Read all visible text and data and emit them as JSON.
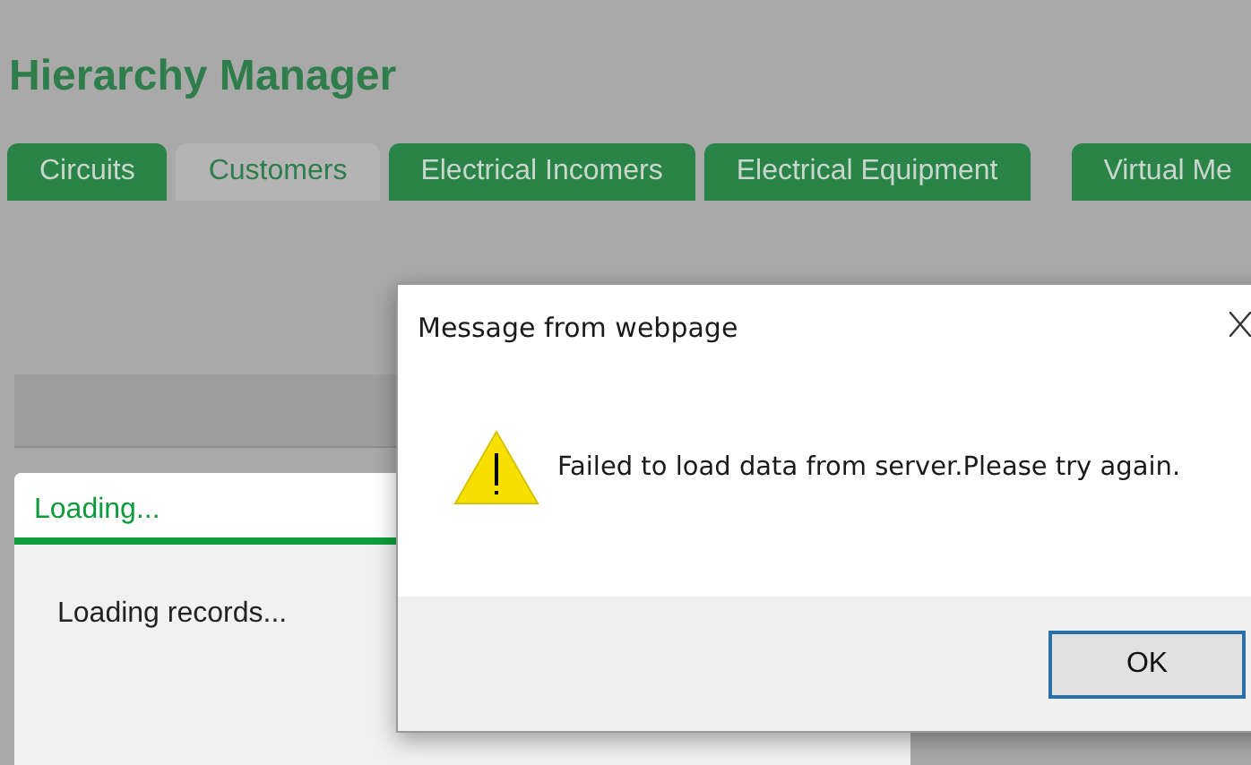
{
  "page": {
    "title": "Hierarchy Manager"
  },
  "tabs": [
    {
      "label": "Circuits",
      "selected": false
    },
    {
      "label": "Customers",
      "selected": true
    },
    {
      "label": "Electrical Incomers",
      "selected": false
    },
    {
      "label": "Electrical Equipment",
      "selected": false
    },
    {
      "label": "Virtual Me",
      "selected": false
    }
  ],
  "loading_panel": {
    "title": "Loading...",
    "message": "Loading records..."
  },
  "dialog": {
    "title": "Message from webpage",
    "message": "Failed to load data from server.Please try again.",
    "buttons": [
      "OK"
    ]
  }
}
